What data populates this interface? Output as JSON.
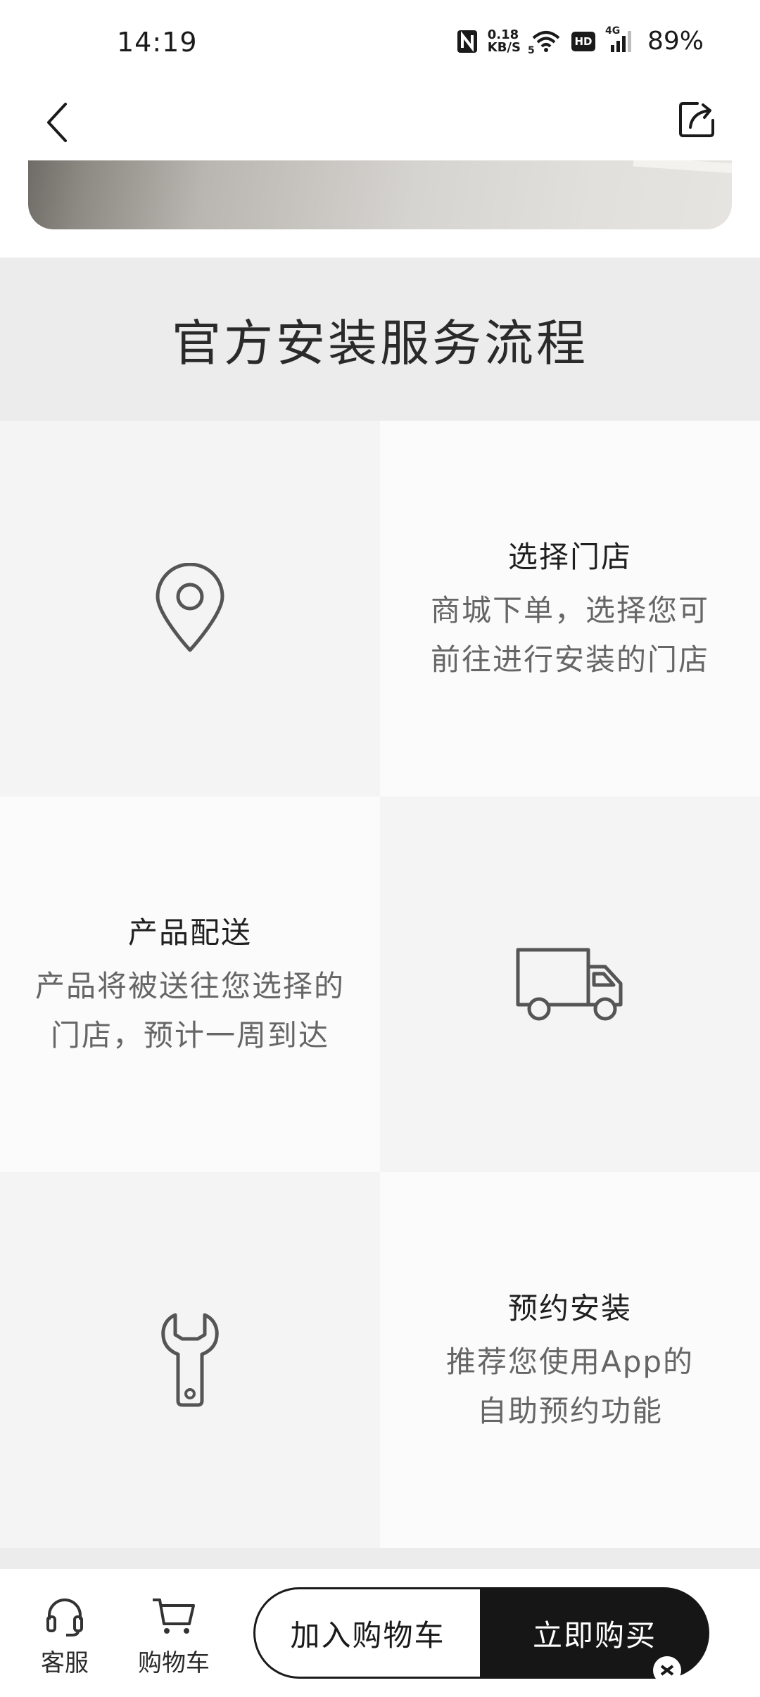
{
  "status_bar": {
    "time": "14:19",
    "net_speed_value": "0.18",
    "net_speed_unit": "KB/S",
    "wifi_badge": "5",
    "hd_badge": "HD",
    "signal_badge": "4G",
    "battery": "89%"
  },
  "nav": {
    "back_icon": "chevron-left-icon",
    "share_icon": "share-icon"
  },
  "section": {
    "title": "官方安装服务流程"
  },
  "steps": [
    {
      "title": "选择门店",
      "description": "商城下单，选择您可\n前往进行安装的门店",
      "icon": "location-pin-icon"
    },
    {
      "title": "产品配送",
      "description": "产品将被送往您选择的\n门店，预计一周到达",
      "icon": "truck-icon"
    },
    {
      "title": "预约安装",
      "description": "推荐您使用App的\n自助预约功能",
      "icon": "wrench-icon"
    }
  ],
  "bottom_bar": {
    "service_label": "客服",
    "cart_label": "购物车",
    "add_to_cart_label": "加入购物车",
    "buy_now_label": "立即购买"
  },
  "colors": {
    "section_header_bg": "#ececec",
    "cell_gray": "#f4f4f4",
    "cell_white": "#fbfbfb",
    "buy_button_bg": "#161616"
  }
}
